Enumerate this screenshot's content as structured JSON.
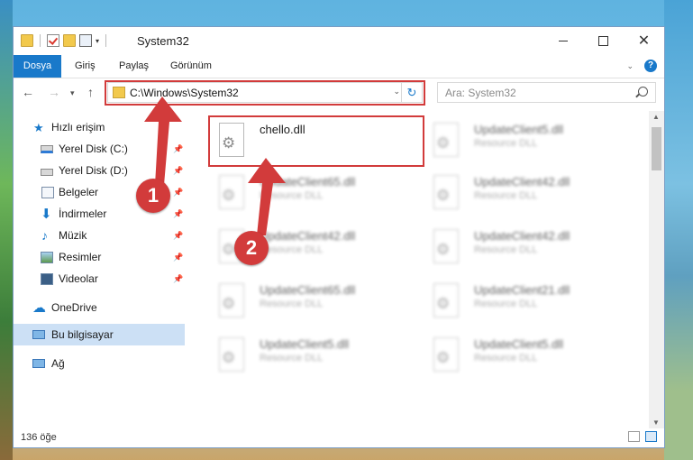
{
  "window": {
    "title": "System32",
    "controls": {
      "minimize": "—",
      "maximize": "□",
      "close": "✕"
    }
  },
  "ribbon": {
    "tabs": [
      "Dosya",
      "Giriş",
      "Paylaş",
      "Görünüm"
    ],
    "help": "?"
  },
  "address": {
    "path": "C:\\Windows\\System32",
    "refresh_glyph": "↻",
    "dropdown_glyph": "⌄"
  },
  "search": {
    "placeholder": "Ara: System32"
  },
  "sidebar": {
    "items": [
      {
        "label": "Hızlı erişim",
        "icon": "star-icon"
      },
      {
        "label": "Yerel Disk (C:)",
        "icon": "drive-c-icon",
        "pinned": true
      },
      {
        "label": "Yerel Disk (D:)",
        "icon": "drive-d-icon",
        "pinned": true
      },
      {
        "label": "Belgeler",
        "icon": "documents-icon",
        "pinned": true
      },
      {
        "label": "İndirmeler",
        "icon": "downloads-icon",
        "pinned": true
      },
      {
        "label": "Müzik",
        "icon": "music-icon",
        "pinned": true
      },
      {
        "label": "Resimler",
        "icon": "pictures-icon",
        "pinned": true
      },
      {
        "label": "Videolar",
        "icon": "videos-icon",
        "pinned": true
      },
      {
        "label": "OneDrive",
        "icon": "onedrive-icon"
      },
      {
        "label": "Bu bilgisayar",
        "icon": "this-pc-icon",
        "selected": true
      },
      {
        "label": "Ağ",
        "icon": "network-icon"
      }
    ]
  },
  "files": [
    {
      "name": "chello.dll",
      "type": "",
      "highlighted": true
    },
    {
      "name": "UpdateClient5.dll",
      "type": "Resource DLL"
    },
    {
      "name": "UpdateClient65.dll",
      "type": "Resource DLL"
    },
    {
      "name": "UpdateClient42.dll",
      "type": "Resource DLL"
    },
    {
      "name": "UpdateClient42.dll",
      "type": "Resource DLL"
    },
    {
      "name": "UpdateClient42.dll",
      "type": "Resource DLL"
    },
    {
      "name": "UpdateClient65.dll",
      "type": "Resource DLL"
    },
    {
      "name": "UpdateClient21.dll",
      "type": "Resource DLL"
    },
    {
      "name": "UpdateClient5.dll",
      "type": "Resource DLL"
    },
    {
      "name": "UpdateClient5.dll",
      "type": "Resource DLL"
    }
  ],
  "status": {
    "item_count": "136 öğe"
  },
  "annotations": {
    "step1": "1",
    "step2": "2",
    "color": "#d23b3b"
  }
}
